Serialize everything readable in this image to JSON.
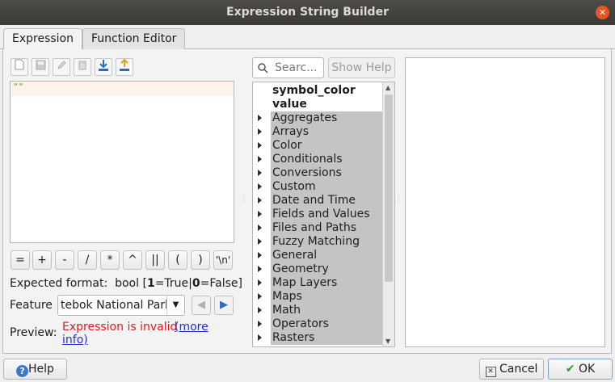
{
  "window": {
    "title": "Expression String Builder"
  },
  "tabs": [
    {
      "label": "Expression"
    },
    {
      "label": "Function Editor"
    }
  ],
  "editor": {
    "content": "\"\""
  },
  "operators": [
    "=",
    "+",
    "-",
    "/",
    "*",
    "^",
    "||",
    "(",
    ")",
    "'\\n'"
  ],
  "expected_format": {
    "label": "Expected format:",
    "value_prefix": "bool [",
    "one": "1",
    "eq_true": "=True|",
    "zero": "0",
    "eq_false": "=False]"
  },
  "feature": {
    "label": "Feature",
    "value": "tebok National Park"
  },
  "preview": {
    "label": "Preview:",
    "error": "Expression is invalid",
    "link": "(more info)",
    "link_line1": "(more",
    "link_line2": "info)"
  },
  "search": {
    "placeholder": "Searc..."
  },
  "show_help": {
    "label": "Show Help"
  },
  "tree": {
    "top_items": [
      "symbol_color",
      "value"
    ],
    "groups": [
      "Aggregates",
      "Arrays",
      "Color",
      "Conditionals",
      "Conversions",
      "Custom",
      "Date and Time",
      "Fields and Values",
      "Files and Paths",
      "Fuzzy Matching",
      "General",
      "Geometry",
      "Map Layers",
      "Maps",
      "Math",
      "Operators",
      "Rasters"
    ]
  },
  "buttons": {
    "help": "Help",
    "cancel": "Cancel",
    "ok": "OK"
  },
  "colors": {
    "error": "#e01b1b",
    "link": "#2b2bd6",
    "close": "#e95420",
    "selection": "#c4c4c4"
  }
}
